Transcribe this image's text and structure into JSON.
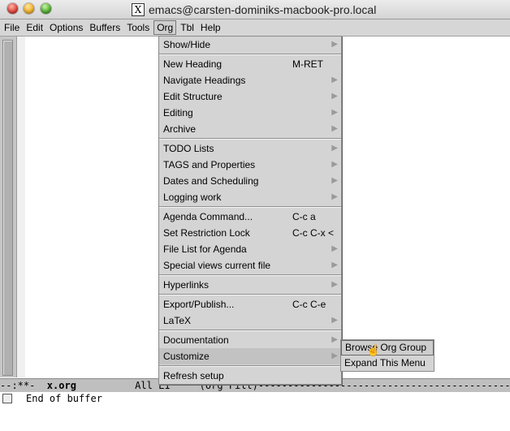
{
  "window": {
    "title": "emacs@carsten-dominiks-macbook-pro.local",
    "x_icon": "X"
  },
  "menubar": {
    "items": [
      "File",
      "Edit",
      "Options",
      "Buffers",
      "Tools",
      "Org",
      "Tbl",
      "Help"
    ]
  },
  "org_menu": {
    "show_hide": "Show/Hide",
    "new_heading": "New Heading",
    "new_heading_key": "M-RET",
    "navigate": "Navigate Headings",
    "edit_structure": "Edit Structure",
    "editing": "Editing",
    "archive": "Archive",
    "todo": "TODO Lists",
    "tags": "TAGS and Properties",
    "dates": "Dates and Scheduling",
    "logging": "Logging work",
    "agenda": "Agenda Command...",
    "agenda_key": "C-c a",
    "restriction": "Set Restriction Lock",
    "restriction_key": "C-c C-x <",
    "file_list": "File List for Agenda",
    "special_views": "Special views current file",
    "hyperlinks": "Hyperlinks",
    "export": "Export/Publish...",
    "export_key": "C-c C-e",
    "latex": "LaTeX",
    "documentation": "Documentation",
    "customize": "Customize",
    "refresh": "Refresh setup"
  },
  "submenu": {
    "browse": "Browse Org Group",
    "expand": "Expand This Menu"
  },
  "modeline": {
    "left": "--:**-  ",
    "buffer": "x.org",
    "rest": "          All L1     (Org Fill)----------------------------------------------"
  },
  "minibuffer": "End of buffer"
}
